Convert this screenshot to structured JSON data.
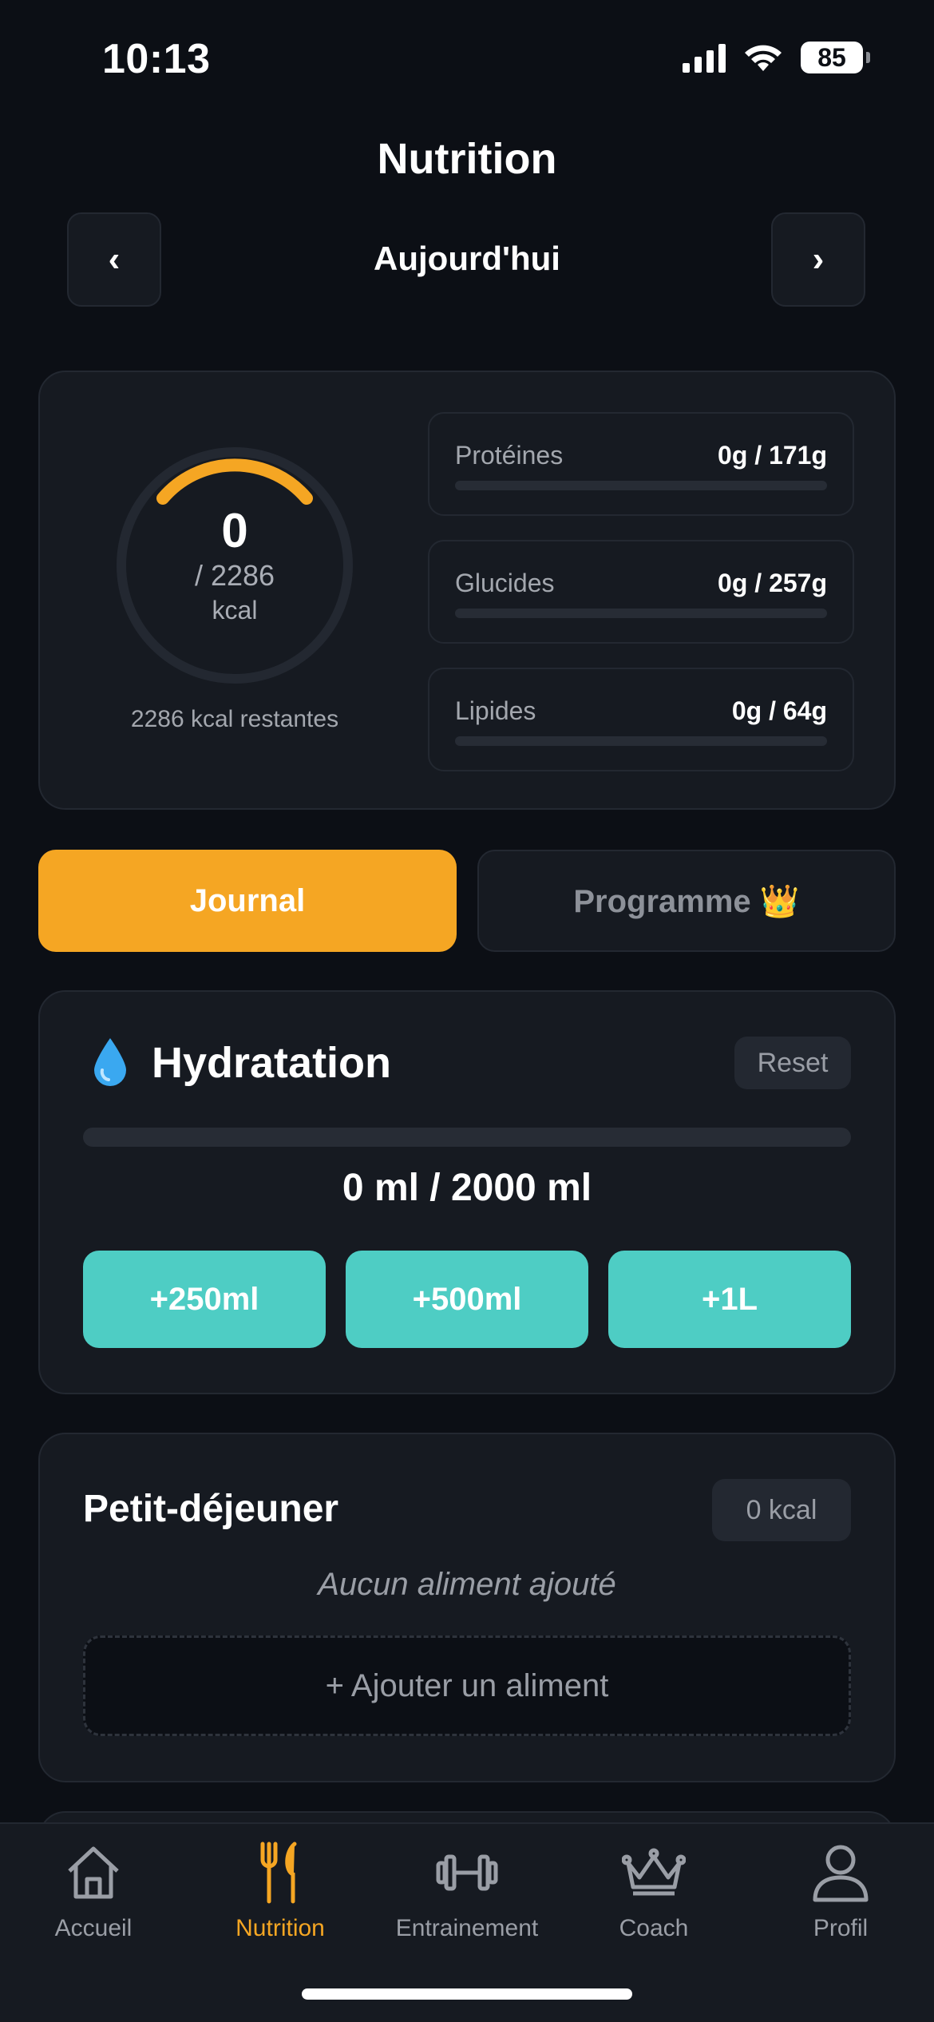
{
  "status_bar": {
    "time": "10:13",
    "battery": "85"
  },
  "header": {
    "title": "Nutrition",
    "prev_label": "‹",
    "next_label": "›",
    "date_label": "Aujourd'hui"
  },
  "summary": {
    "calories_consumed": "0",
    "calories_goal": "/ 2286",
    "calories_unit": "kcal",
    "remaining_text": "2286 kcal restantes",
    "ring_progress": 0,
    "macros": [
      {
        "label": "Protéines",
        "value": "0g / 171g",
        "progress": 0
      },
      {
        "label": "Glucides",
        "value": "0g / 257g",
        "progress": 0
      },
      {
        "label": "Lipides",
        "value": "0g / 64g",
        "progress": 0
      }
    ]
  },
  "tabs": {
    "journal": "Journal",
    "programme": "Programme 👑"
  },
  "hydration": {
    "icon": "water-drop-icon",
    "title": "Hydratation",
    "reset_label": "Reset",
    "amount_text": "0 ml / 2000 ml",
    "progress": 0,
    "buttons": [
      "+250ml",
      "+500ml",
      "+1L"
    ]
  },
  "meal": {
    "title": "Petit-déjeuner",
    "kcal_badge": "0 kcal",
    "empty_text": "Aucun aliment ajouté",
    "add_label": "+ Ajouter un aliment"
  },
  "tabbar": {
    "items": [
      {
        "label": "Accueil",
        "icon": "home-icon"
      },
      {
        "label": "Nutrition",
        "icon": "fork-knife-icon",
        "active": true
      },
      {
        "label": "Entrainement",
        "icon": "dumbbell-icon"
      },
      {
        "label": "Coach",
        "icon": "crown-icon"
      },
      {
        "label": "Profil",
        "icon": "profile-icon"
      }
    ]
  },
  "colors": {
    "accent": "#f5a623",
    "teal": "#4ecdc4",
    "background": "#0c0f15",
    "card": "#161a21"
  }
}
